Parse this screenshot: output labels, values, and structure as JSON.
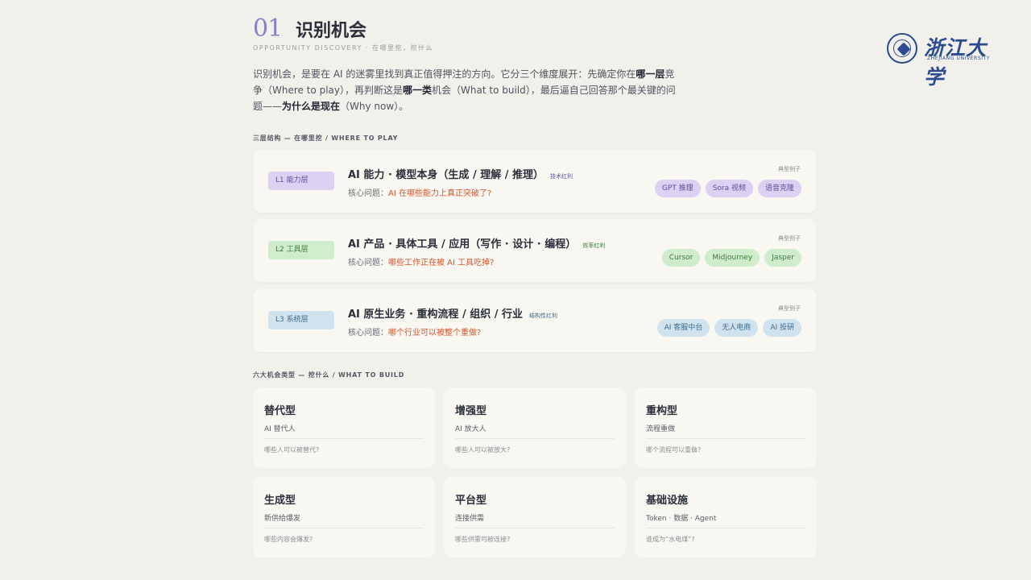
{
  "header": {
    "number": "01",
    "title": "识别机会",
    "subtitle": "OPPORTUNITY DISCOVERY · 在哪里挖，挖什么"
  },
  "intro": {
    "p1": "识别机会，是要在 AI 的迷雾里找到真正值得押注的方向。它分三个维度展开：先确定你在",
    "b1": "哪一层",
    "p2": "竞争（Where to play），再判断这是",
    "b2": "哪一类",
    "p3": "机会（What to build），最后逼自己回答那个最关键的问题——",
    "b3": "为什么是现在",
    "p4": "（Why now）。"
  },
  "levels_section": {
    "label": "三层结构 — 在哪里挖 / WHERE TO PLAY"
  },
  "levels": [
    {
      "tag": "L1  能力层",
      "title": "AI 能力 · 模型本身（生成 / 理解 / 推理）",
      "badge": "技术红利",
      "question_prefix": "核心问题：",
      "question": "AI 在哪些能力上真正突破了?",
      "examples_label": "典型例子",
      "chips": [
        "GPT 推理",
        "Sora 视频",
        "语音克隆"
      ]
    },
    {
      "tag": "L2  工具层",
      "title": "AI 产品 · 具体工具 / 应用（写作 · 设计 · 编程）",
      "badge": "效率红利",
      "question_prefix": "核心问题：",
      "question": "哪些工作正在被 AI 工具吃掉?",
      "examples_label": "典型例子",
      "chips": [
        "Cursor",
        "Midjourney",
        "Jasper"
      ]
    },
    {
      "tag": "L3  系统层",
      "title": "AI 原生业务 · 重构流程 / 组织 / 行业",
      "badge": "结构性红利",
      "question_prefix": "核心问题：",
      "question": "哪个行业可以被整个重做?",
      "examples_label": "典型例子",
      "chips": [
        "AI 客服中台",
        "无人电商",
        "AI 投研"
      ]
    }
  ],
  "types_section": {
    "label": "六大机会类型 — 挖什么 / WHAT TO BUILD"
  },
  "types": [
    {
      "name": "替代型",
      "sub": "AI 替代人",
      "q": "哪些人可以被替代?"
    },
    {
      "name": "增强型",
      "sub": "AI 放大人",
      "q": "哪些人可以被放大?"
    },
    {
      "name": "重构型",
      "sub": "流程重做",
      "q": "哪个流程可以重做?"
    },
    {
      "name": "生成型",
      "sub": "新供给爆发",
      "q": "哪些内容会爆发?"
    },
    {
      "name": "平台型",
      "sub": "连接供需",
      "q": "哪些供需可被连接?"
    },
    {
      "name": "基础设施",
      "sub": "Token · 数据 · Agent",
      "q": "谁成为“水电煤”?"
    }
  ],
  "logo": {
    "cn": "浙江大学",
    "en": "ZHEJIANG UNIVERSITY",
    "primary_color": "#2d4b8f"
  }
}
